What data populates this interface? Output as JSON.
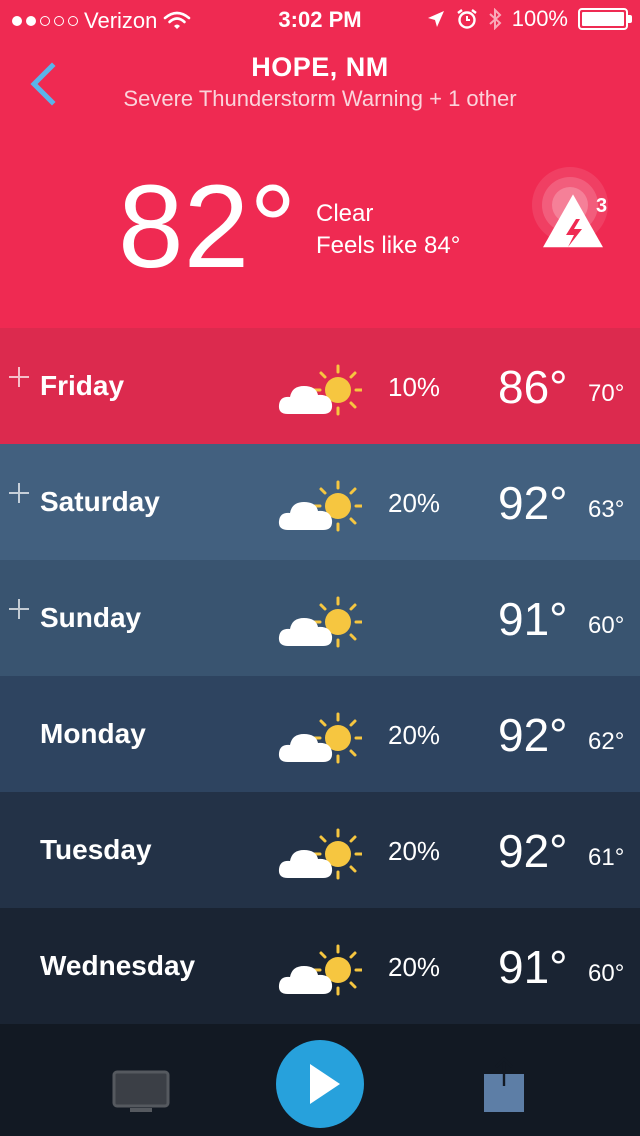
{
  "status_bar": {
    "carrier": "Verizon",
    "time": "3:02 PM",
    "battery": "100%"
  },
  "header": {
    "city": "HOPE, NM",
    "warning": "Severe Thunderstorm Warning + 1 other",
    "temperature": "82°",
    "condition": "Clear",
    "feels_like": "Feels like 84°",
    "alert_count": "3"
  },
  "forecast": [
    {
      "day": "Friday",
      "precip": "10%",
      "high": "86°",
      "low": "70°",
      "expandable": true,
      "bg": "#dc2a4e"
    },
    {
      "day": "Saturday",
      "precip": "20%",
      "high": "92°",
      "low": "63°",
      "expandable": true,
      "bg": "#42607f"
    },
    {
      "day": "Sunday",
      "precip": "",
      "high": "91°",
      "low": "60°",
      "expandable": true,
      "bg": "#395470"
    },
    {
      "day": "Monday",
      "precip": "20%",
      "high": "92°",
      "low": "62°",
      "expandable": false,
      "bg": "#2e4460"
    },
    {
      "day": "Tuesday",
      "precip": "20%",
      "high": "92°",
      "low": "61°",
      "expandable": false,
      "bg": "#233247"
    },
    {
      "day": "Wednesday",
      "precip": "20%",
      "high": "91°",
      "low": "60°",
      "expandable": false,
      "bg": "#1a2433"
    }
  ],
  "icons": {
    "back": "chevron-left-icon",
    "alert": "lightning-alert-icon",
    "weather": "partly-sunny-icon",
    "tv": "tv-icon",
    "play": "play-icon",
    "share": "share-icon"
  },
  "colors": {
    "header_bg": "#ef2a52",
    "accent_blue": "#27a1dc",
    "sun": "#f6c640"
  }
}
